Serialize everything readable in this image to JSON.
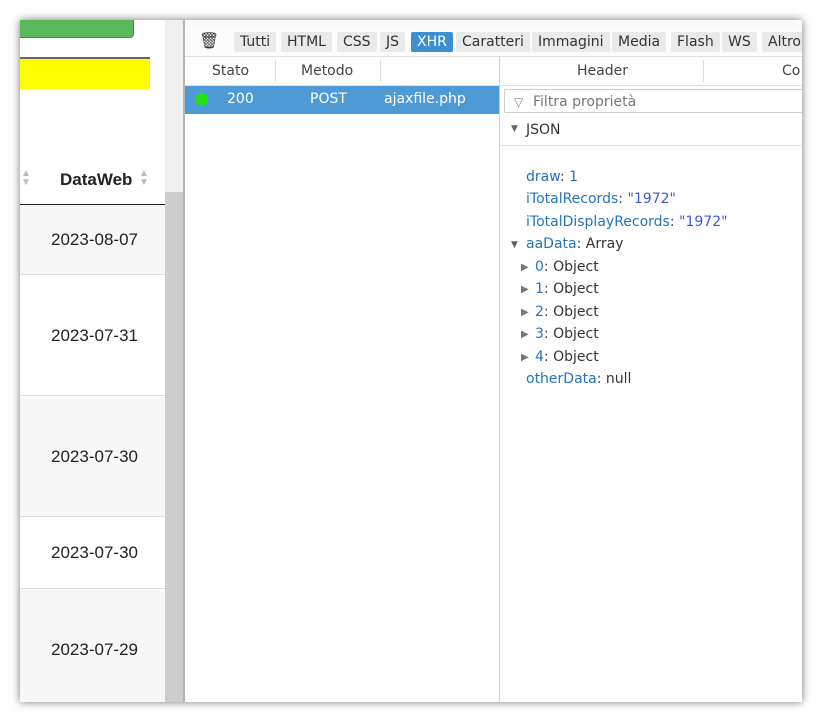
{
  "webpage": {
    "column_title": "DataWeb",
    "rows": [
      "2023-08-07",
      "2023-07-31",
      "2023-07-30",
      "2023-07-30",
      "2023-07-29"
    ]
  },
  "devtools": {
    "filters": [
      "Tutti",
      "HTML",
      "CSS",
      "JS",
      "XHR",
      "Caratteri",
      "Immagini",
      "Media",
      "Flash",
      "WS",
      "Altro"
    ],
    "active_filter": "XHR",
    "columns": {
      "stato": "Stato",
      "metodo": "Metodo"
    },
    "request": {
      "status": "200",
      "method": "POST",
      "file": "ajaxfile.php"
    },
    "detail_tabs": {
      "header": "Header",
      "cookie": "Co"
    },
    "filter_placeholder": "Filtra proprietà",
    "json_label": "JSON",
    "json": {
      "draw_key": "draw",
      "draw_val": "1",
      "total_key": "iTotalRecords",
      "total_val": "\"1972\"",
      "display_key": "iTotalDisplayRecords",
      "display_val": "\"1972\"",
      "aadata_key": "aaData",
      "aadata_type": "Array",
      "items": [
        {
          "index": "0",
          "type": "Object"
        },
        {
          "index": "1",
          "type": "Object"
        },
        {
          "index": "2",
          "type": "Object"
        },
        {
          "index": "3",
          "type": "Object"
        },
        {
          "index": "4",
          "type": "Object"
        }
      ],
      "other_key": "otherData",
      "other_val": "null"
    }
  }
}
